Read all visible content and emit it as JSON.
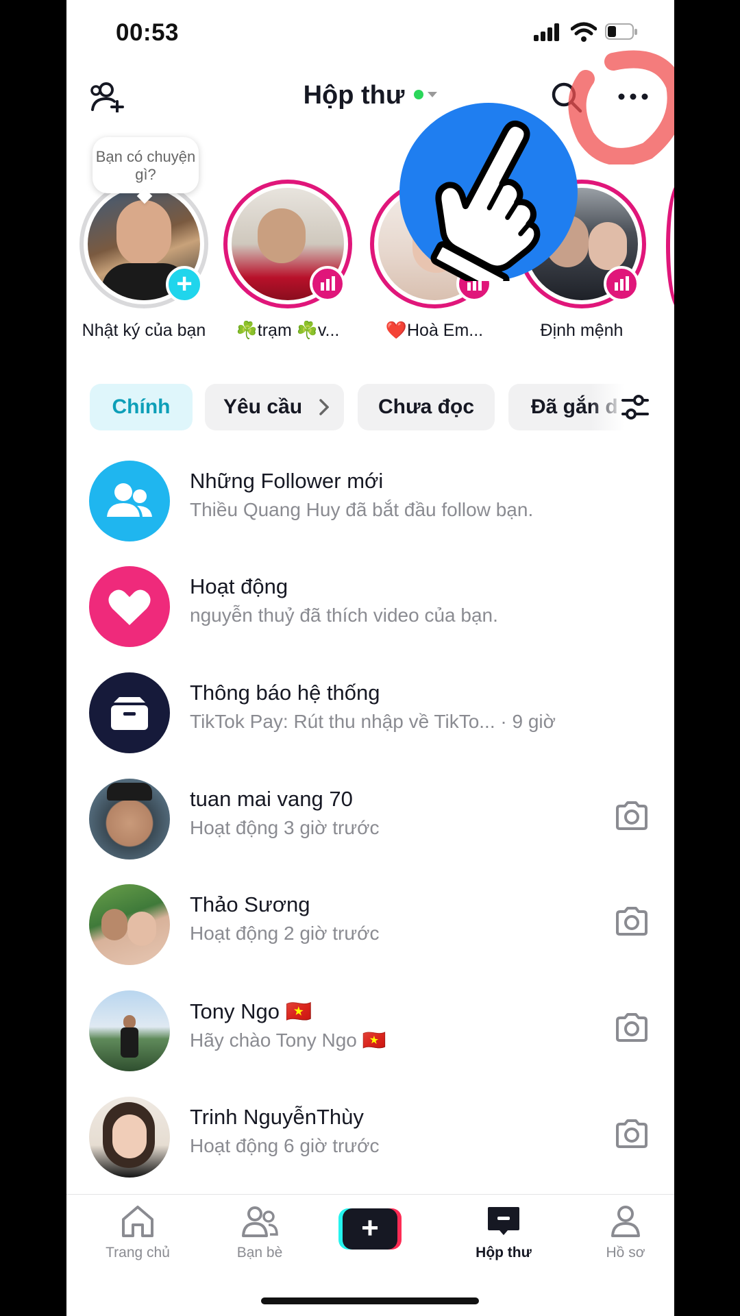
{
  "status_bar": {
    "time": "00:53"
  },
  "header": {
    "title": "Hộp thư"
  },
  "stories": {
    "bubble_text": "Bạn có chuyện gì?",
    "items": [
      {
        "name": "Nhật ký của bạn",
        "badge": "add"
      },
      {
        "name": "☘️trạm ☘️v...",
        "badge": "live"
      },
      {
        "name": "❤️Hoà Em...",
        "badge": "live"
      },
      {
        "name": "Định mệnh",
        "badge": "live"
      }
    ]
  },
  "tabs": [
    {
      "label": "Chính"
    },
    {
      "label": "Yêu cầu"
    },
    {
      "label": "Chưa đọc"
    },
    {
      "label": "Đã gắn d"
    }
  ],
  "inbox": [
    {
      "title": "Những Follower mới",
      "subtitle": "Thiều Quang Huy đã bắt đầu follow bạn."
    },
    {
      "title": "Hoạt động",
      "subtitle": "nguyễn thuỷ đã thích video của bạn."
    },
    {
      "title": "Thông báo hệ thống",
      "subtitle": "TikTok Pay: Rút thu nhập về TikTo... · 9 giờ"
    },
    {
      "title": "tuan mai vang 70",
      "subtitle": "Hoạt động 3 giờ trước"
    },
    {
      "title": "Thảo Sương",
      "subtitle": "Hoạt động 2 giờ trước"
    },
    {
      "title": "Tony Ngo 🇻🇳",
      "subtitle": "Hãy chào Tony Ngo 🇻🇳"
    },
    {
      "title": "Trinh NguyễnThùy",
      "subtitle": "Hoạt động 6 giờ trước"
    }
  ],
  "bottom_nav": [
    {
      "label": "Trang chủ"
    },
    {
      "label": "Bạn bè"
    },
    {
      "label": ""
    },
    {
      "label": "Hộp thư"
    },
    {
      "label": "Hồ sơ"
    }
  ],
  "colors": {
    "accent_pink": "#e0167a",
    "accent_cyan": "#20d5ec",
    "active_tab_text": "#0d9fb8",
    "overlay_blue": "#1f7ef0",
    "annotation_red": "#f05050"
  },
  "icons": [
    "add-friend-icon",
    "search-icon",
    "more-icon",
    "filter-icon",
    "camera-icon",
    "home-icon",
    "friends-icon",
    "create-icon",
    "inbox-icon",
    "profile-icon",
    "pointing-hand-icon"
  ]
}
